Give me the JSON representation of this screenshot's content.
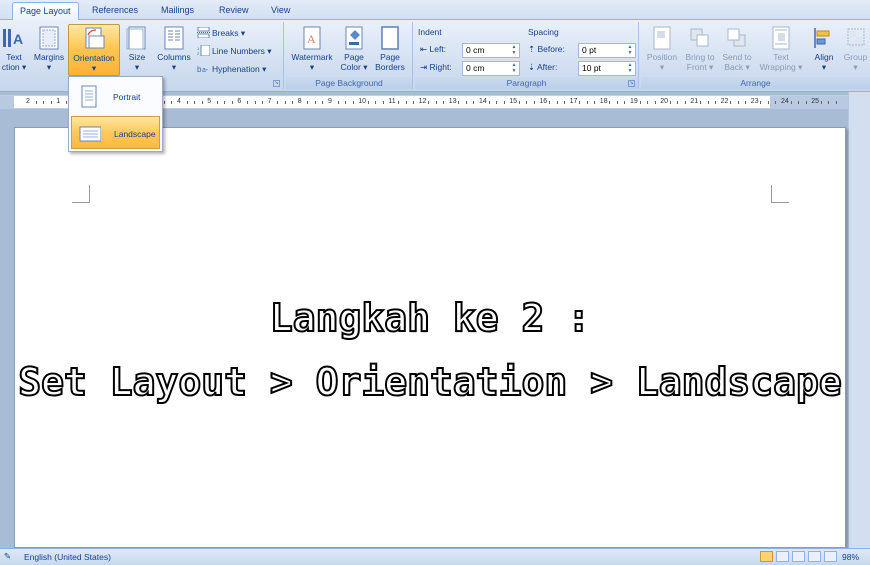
{
  "tabs": [
    "Page Layout",
    "References",
    "Mailings",
    "Review",
    "View"
  ],
  "ribbon": {
    "page_setup": {
      "text_direction_l1": "Text",
      "text_direction_l2": "ction ▾",
      "margins": "Margins",
      "orientation": "Orientation",
      "size": "Size",
      "columns": "Columns",
      "breaks": "Breaks ▾",
      "line_numbers": "Line Numbers ▾",
      "hyphenation": "Hyphenation ▾"
    },
    "page_background": {
      "label": "Page Background",
      "watermark": "Watermark",
      "page_color_l1": "Page",
      "page_color_l2": "Color ▾",
      "page_borders_l1": "Page",
      "page_borders_l2": "Borders"
    },
    "paragraph": {
      "label": "Paragraph",
      "indent_title": "Indent",
      "left_label": "Left:",
      "left_value": "0 cm",
      "right_label": "Right:",
      "right_value": "0 cm",
      "spacing_title": "Spacing",
      "before_label": "Before:",
      "before_value": "0 pt",
      "after_label": "After:",
      "after_value": "10 pt"
    },
    "arrange": {
      "label": "Arrange",
      "position": "Position",
      "bring_to_front_l1": "Bring to",
      "bring_to_front_l2": "Front ▾",
      "send_to_back_l1": "Send to",
      "send_to_back_l2": "Back ▾",
      "text_wrapping_l1": "Text",
      "text_wrapping_l2": "Wrapping ▾",
      "align": "Align",
      "group": "Group"
    }
  },
  "dropdown": {
    "portrait": "Portrait",
    "landscape": "Landscape"
  },
  "ruler": {
    "numbers": [
      "2",
      "1",
      "1",
      "2",
      "3",
      "4",
      "5",
      "6",
      "7",
      "8",
      "9",
      "10",
      "11",
      "12",
      "13",
      "14",
      "15",
      "16",
      "17",
      "18",
      "19",
      "20",
      "21",
      "22",
      "23",
      "24",
      "25"
    ]
  },
  "document": {
    "line1": "Langkah ke 2 :",
    "line2": "Set Layout > Orientation > Landscape"
  },
  "status": {
    "language": "English (United States)",
    "zoom": "98%"
  }
}
